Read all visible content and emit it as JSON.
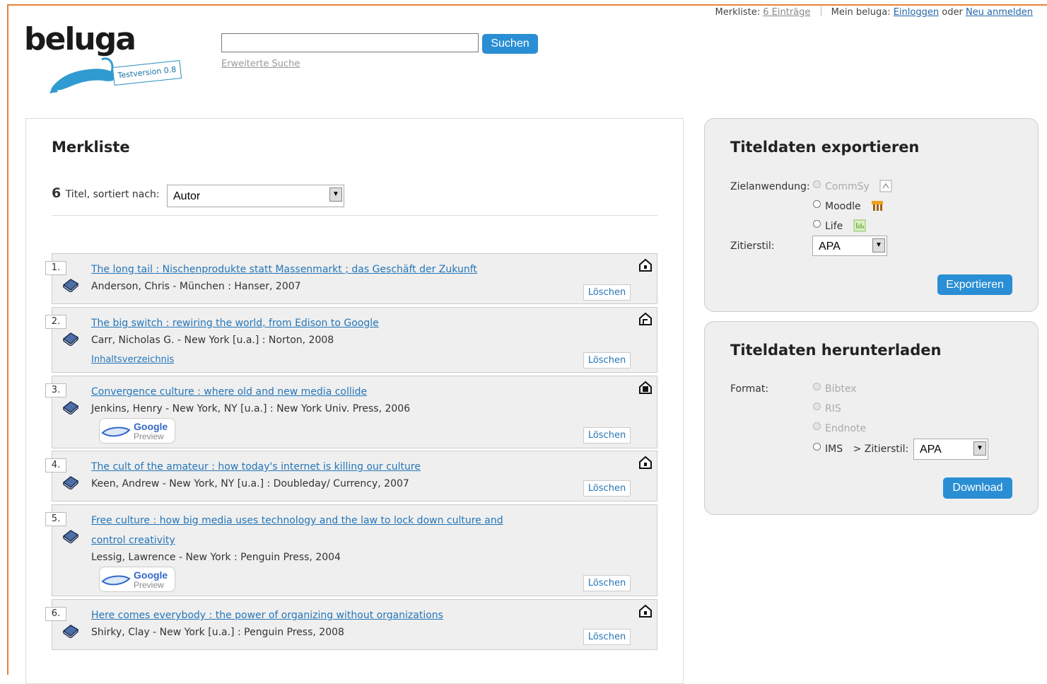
{
  "topbar": {
    "merkliste_label": "Merkliste:",
    "merkliste_link": "6 Einträge",
    "mein_label": "Mein beluga:",
    "login_link": "Einloggen",
    "or_label": "oder",
    "register_link": "Neu anmelden"
  },
  "logo": {
    "word": "beluga",
    "badge": "Testversion 0.8"
  },
  "search": {
    "value": "",
    "button": "Suchen",
    "advanced": "Erweiterte Suche"
  },
  "merkliste": {
    "title": "Merkliste",
    "count": "6",
    "sort_label": "Titel, sortiert nach:",
    "sort_value": "Autor",
    "delete_label": "Löschen",
    "items": [
      {
        "num": "1.",
        "title_line1": "The long tail : Nischenprodukte statt Massenmarkt ; das Geschäft der Zukunft",
        "title_line2": "",
        "meta": "Anderson, Chris - München : Hanser, 2007"
      },
      {
        "num": "2.",
        "title_line1": "The big switch : rewiring the world, from Edison to Google",
        "title_line2": "",
        "meta": "Carr, Nicholas G. - New York [u.a.] : Norton, 2008",
        "toc": "Inhaltsverzeichnis"
      },
      {
        "num": "3.",
        "title_line1": "Convergence culture : where old and new media collide",
        "title_line2": "",
        "meta": "Jenkins, Henry - New York, NY [u.a.] : New York Univ. Press, 2006",
        "preview_top": "Google",
        "preview_bottom": "Preview"
      },
      {
        "num": "4.",
        "title_line1": "The cult of the amateur : how today's internet is killing our culture",
        "title_line2": "",
        "meta": "Keen, Andrew - New York, NY [u.a.] : Doubleday/ Currency, 2007"
      },
      {
        "num": "5.",
        "title_line1": "Free culture : how big media uses technology and the law to lock down culture and",
        "title_line2": "control creativity",
        "meta": "Lessig, Lawrence - New York : Penguin Press, 2004",
        "preview_top": "Google",
        "preview_bottom": "Preview"
      },
      {
        "num": "6.",
        "title_line1": "Here comes everybody : the power of organizing without organizations",
        "title_line2": "",
        "meta": "Shirky, Clay - New York [u.a.] : Penguin Press, 2008"
      }
    ]
  },
  "export": {
    "title": "Titeldaten exportieren",
    "target_label": "Zielanwendung:",
    "options": [
      "CommSy",
      "Moodle",
      "Life"
    ],
    "cite_label": "Zitierstil:",
    "cite_value": "APA",
    "button": "Exportieren"
  },
  "download": {
    "title": "Titeldaten herunterladen",
    "format_label": "Format:",
    "options": [
      "Bibtex",
      "RIS",
      "Endnote",
      "IMS"
    ],
    "cite_label": "> Zitierstil:",
    "cite_value": "APA",
    "button": "Download"
  },
  "colors": {
    "accent": "#2a8ed4",
    "link": "#2576b8",
    "frame": "#e8823a",
    "panel_bg": "#efefef"
  },
  "icons": {
    "book": "book-icon",
    "availability": "house-icon",
    "commsy": "commsy-icon",
    "moodle": "moodle-icon",
    "life": "life-icon",
    "dropdown": "chevron-down-icon"
  }
}
